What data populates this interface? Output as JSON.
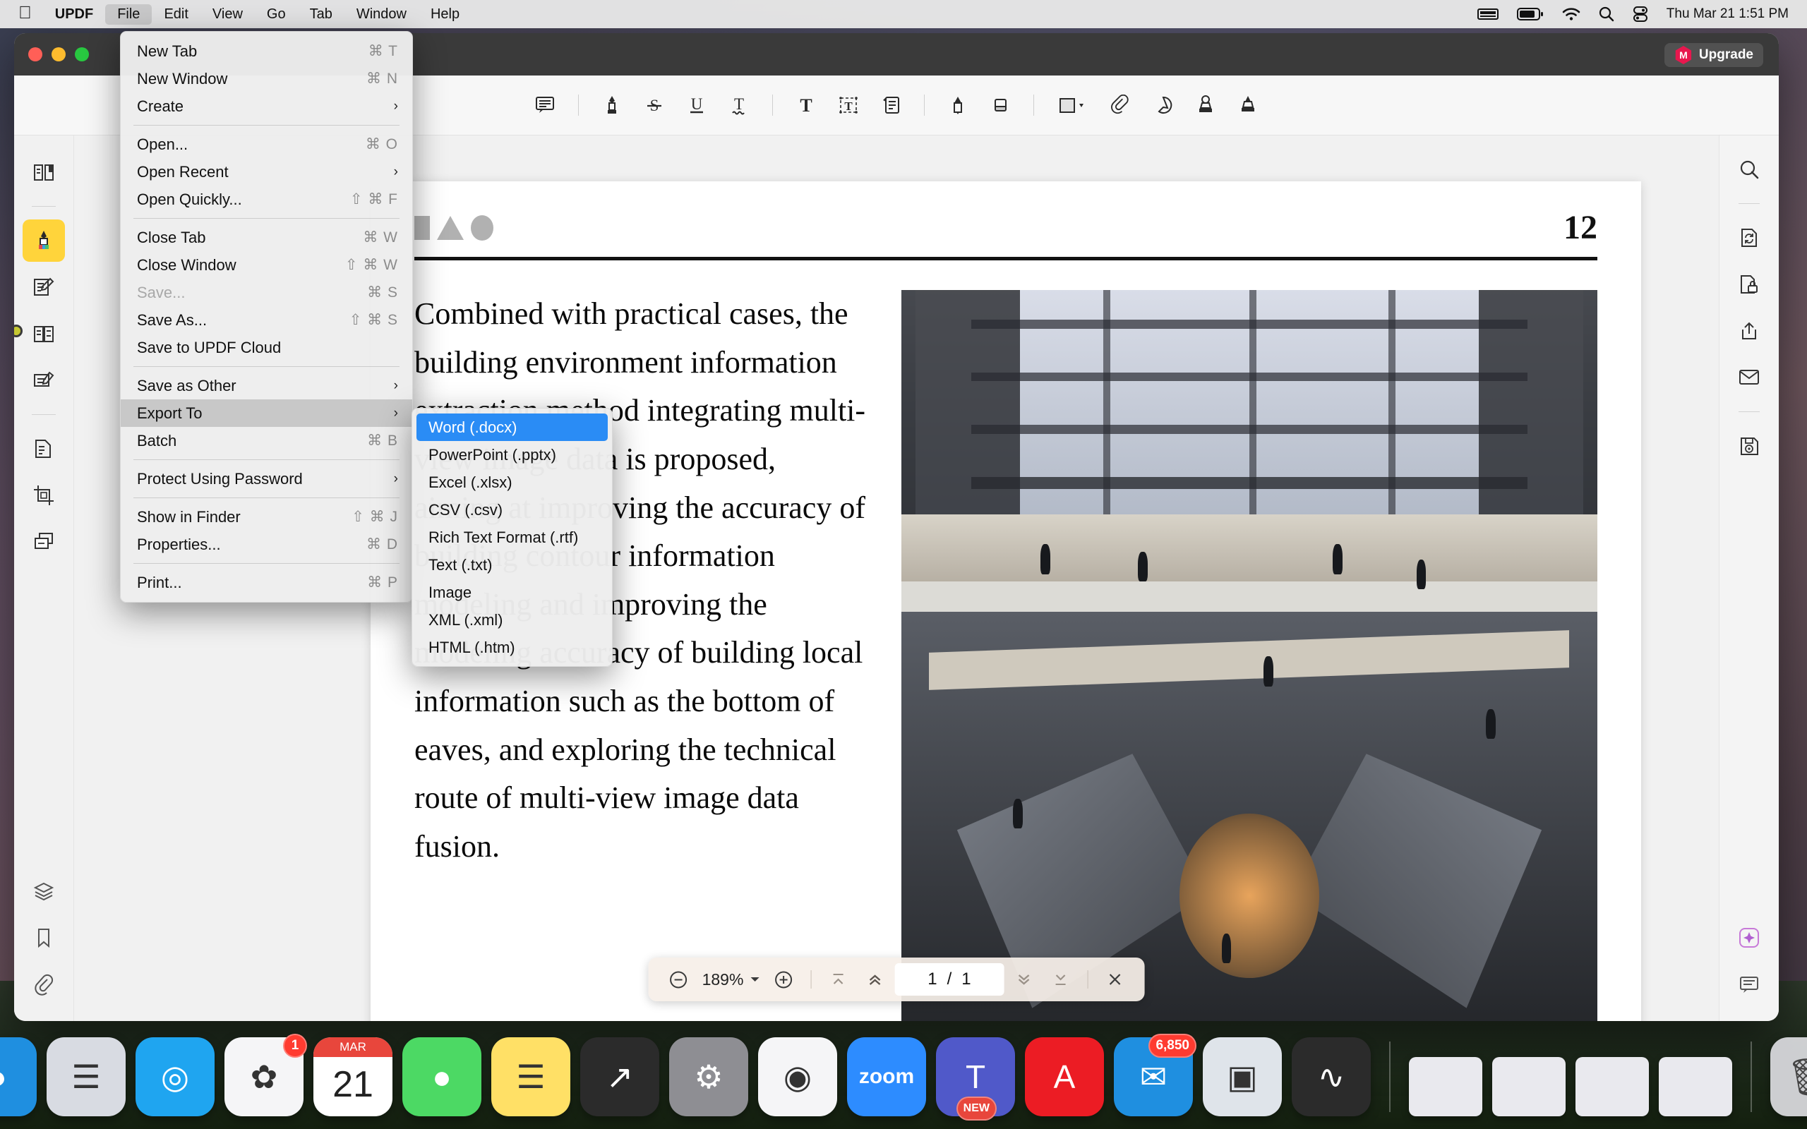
{
  "menubar": {
    "apple_icon": "apple-logo",
    "items": [
      {
        "label": "UPDF",
        "bold": true,
        "active": false
      },
      {
        "label": "File",
        "bold": false,
        "active": true
      },
      {
        "label": "Edit",
        "bold": false,
        "active": false
      },
      {
        "label": "View",
        "bold": false,
        "active": false
      },
      {
        "label": "Go",
        "bold": false,
        "active": false
      },
      {
        "label": "Tab",
        "bold": false,
        "active": false
      },
      {
        "label": "Window",
        "bold": false,
        "active": false
      },
      {
        "label": "Help",
        "bold": false,
        "active": false
      }
    ],
    "status": {
      "keyboard_icon": "keyboard-icon",
      "battery_icon": "battery-icon",
      "wifi_icon": "wifi-icon",
      "search_icon": "spotlight-search-icon",
      "control_center_icon": "control-center-icon",
      "clock": "Thu Mar 21  1:51 PM"
    }
  },
  "window": {
    "upgrade_label": "Upgrade",
    "upgrade_badge": "M",
    "upgrade_badge_color": "#e8174e"
  },
  "toolbar": {
    "groups": [
      {
        "items": [
          {
            "name": "comment-icon",
            "title": "Comment"
          }
        ]
      },
      {
        "items": [
          {
            "name": "highlight-icon",
            "title": "Highlight"
          },
          {
            "name": "strikethrough-icon",
            "title": "Strikethrough"
          },
          {
            "name": "underline-icon",
            "title": "Underline"
          },
          {
            "name": "squiggly-underline-icon",
            "title": "Squiggly"
          }
        ]
      },
      {
        "items": [
          {
            "name": "text-icon",
            "title": "Text"
          },
          {
            "name": "text-box-icon",
            "title": "Text Box"
          },
          {
            "name": "sticky-note-icon",
            "title": "Note"
          }
        ]
      },
      {
        "items": [
          {
            "name": "pencil-icon",
            "title": "Pencil"
          },
          {
            "name": "eraser-icon",
            "title": "Eraser"
          }
        ]
      },
      {
        "items": [
          {
            "name": "shape-icon",
            "title": "Shapes",
            "has_dropdown": true
          },
          {
            "name": "paperclip-icon",
            "title": "Attachment"
          },
          {
            "name": "sticker-icon",
            "title": "Sticker"
          },
          {
            "name": "stamp-icon",
            "title": "Stamp"
          },
          {
            "name": "signature-icon",
            "title": "Signature"
          }
        ]
      }
    ]
  },
  "left_rail": {
    "items": [
      {
        "name": "sidebar-item-reader",
        "icon": "book-reader-icon",
        "selected": false
      },
      {
        "name": "sidebar-item-annotate",
        "icon": "highlighter-icon",
        "selected": true
      },
      {
        "name": "sidebar-item-edit-pdf",
        "icon": "edit-document-icon",
        "selected": false
      },
      {
        "name": "sidebar-item-organize-pages",
        "icon": "organize-pages-icon",
        "selected": false
      },
      {
        "name": "sidebar-item-form",
        "icon": "form-icon",
        "selected": false
      },
      {
        "name": "sidebar-item-convert",
        "icon": "convert-document-icon",
        "selected": false
      },
      {
        "name": "sidebar-item-crop",
        "icon": "crop-icon",
        "selected": false
      },
      {
        "name": "sidebar-item-compare",
        "icon": "compare-pages-icon",
        "selected": false
      }
    ],
    "bottom_items": [
      {
        "name": "sidebar-item-layers",
        "icon": "layers-icon"
      },
      {
        "name": "sidebar-item-bookmarks",
        "icon": "bookmark-icon"
      },
      {
        "name": "sidebar-item-attachments",
        "icon": "paperclip-icon"
      }
    ]
  },
  "right_rail": {
    "items": [
      {
        "name": "search-button",
        "icon": "search-icon"
      },
      {
        "name": "convert-button",
        "icon": "convert-icon"
      },
      {
        "name": "protect-button",
        "icon": "protect-lock-icon"
      },
      {
        "name": "share-button",
        "icon": "share-upload-icon"
      },
      {
        "name": "email-button",
        "icon": "envelope-icon"
      },
      {
        "name": "save-button",
        "icon": "floppy-save-icon"
      }
    ],
    "bottom_items": [
      {
        "name": "ai-assistant-button",
        "icon": "ai-sparkle-icon"
      },
      {
        "name": "comment-list-button",
        "icon": "comment-icon"
      }
    ]
  },
  "document": {
    "page_number": "12",
    "header_shapes": [
      "square",
      "triangle",
      "circle"
    ],
    "body_text": "Combined with practical cases, the building environment information extraction method integrating multi-view image data is proposed, aiming at improving the accuracy of building contour information modeling and improving the modeling accuracy of building local information such as the bottom of eaves, and exploring the technical route of multi-view image data fusion.",
    "photo_alt": "atrium-interior-photograph"
  },
  "zoombar": {
    "zoom_out_icon": "minus-circle-icon",
    "zoom_level": "189%",
    "zoom_dropdown_icon": "chevron-down-icon",
    "zoom_in_icon": "plus-circle-icon",
    "first_page_icon": "first-page-icon",
    "prev_page_icon": "previous-page-icon",
    "current_page": "1",
    "page_separator": "/",
    "total_pages": "1",
    "next_page_icon": "next-page-icon",
    "last_page_icon": "last-page-icon",
    "close_icon": "close-icon"
  },
  "file_menu": {
    "sections": [
      [
        {
          "label": "New Tab",
          "key": "⌘ T"
        },
        {
          "label": "New Window",
          "key": "⌘ N"
        },
        {
          "label": "Create",
          "submenu": true
        }
      ],
      [
        {
          "label": "Open...",
          "key": "⌘ O"
        },
        {
          "label": "Open Recent",
          "submenu": true
        },
        {
          "label": "Open Quickly...",
          "key": "⇧ ⌘ F"
        }
      ],
      [
        {
          "label": "Close Tab",
          "key": "⌘ W"
        },
        {
          "label": "Close Window",
          "key": "⇧ ⌘ W"
        },
        {
          "label": "Save...",
          "key": "⌘ S",
          "disabled": true
        },
        {
          "label": "Save As...",
          "key": "⇧ ⌘ S"
        },
        {
          "label": "Save to UPDF Cloud"
        }
      ],
      [
        {
          "label": "Save as Other",
          "submenu": true
        },
        {
          "label": "Export To",
          "submenu": true,
          "highlighted": true
        },
        {
          "label": "Batch",
          "key": "⌘ B"
        }
      ],
      [
        {
          "label": "Protect Using Password",
          "submenu": true
        }
      ],
      [
        {
          "label": "Show in Finder",
          "key": "⇧ ⌘ J"
        },
        {
          "label": "Properties...",
          "key": "⌘ D"
        }
      ],
      [
        {
          "label": "Print...",
          "key": "⌘ P"
        }
      ]
    ]
  },
  "export_menu": {
    "items": [
      {
        "label": "Word (.docx)",
        "selected": true
      },
      {
        "label": "PowerPoint (.pptx)",
        "selected": false
      },
      {
        "label": "Excel (.xlsx)",
        "selected": false
      },
      {
        "label": "CSV (.csv)",
        "selected": false
      },
      {
        "label": "Rich Text Format (.rtf)",
        "selected": false
      },
      {
        "label": "Text (.txt)",
        "selected": false
      },
      {
        "label": "Image",
        "selected": false
      },
      {
        "label": "XML (.xml)",
        "selected": false
      },
      {
        "label": "HTML (.htm)",
        "selected": false
      }
    ],
    "selection_color": "#2a8cf5"
  },
  "dock": {
    "items": [
      {
        "name": "dock-finder",
        "glyph": "◕",
        "color": "#1f8fe0",
        "badge": null
      },
      {
        "name": "dock-launchpad",
        "glyph": "☰",
        "color": "#d8dbe2",
        "badge": null
      },
      {
        "name": "dock-safari",
        "glyph": "◎",
        "color": "#1fa5f0",
        "badge": null
      },
      {
        "name": "dock-photos",
        "glyph": "✿",
        "color": "#f5f5f7",
        "badge": "1"
      },
      {
        "name": "dock-calendar",
        "glyph": "21",
        "color": "#ffffff",
        "badge": null,
        "sublabel": "MAR"
      },
      {
        "name": "dock-messages",
        "glyph": "●",
        "color": "#4cd964",
        "badge": null
      },
      {
        "name": "dock-notes",
        "glyph": "☰",
        "color": "#ffe066",
        "badge": null
      },
      {
        "name": "dock-stocks",
        "glyph": "↗",
        "color": "#2b2b2b",
        "badge": null
      },
      {
        "name": "dock-settings",
        "glyph": "⚙",
        "color": "#8e8e93",
        "badge": null
      },
      {
        "name": "dock-chrome",
        "glyph": "◉",
        "color": "#f5f5f7",
        "badge": null
      },
      {
        "name": "dock-zoom",
        "glyph": "zoom",
        "color": "#2d8cff",
        "badge": null
      },
      {
        "name": "dock-teams",
        "glyph": "T",
        "color": "#5059c9",
        "badge": "NEW"
      },
      {
        "name": "dock-acrobat",
        "glyph": "A",
        "color": "#ec1c24",
        "badge": null
      },
      {
        "name": "dock-mail",
        "glyph": "✉",
        "color": "#1f8fe0",
        "badge": "6,850"
      },
      {
        "name": "dock-preview",
        "glyph": "▣",
        "color": "#dfe4ea",
        "badge": null
      },
      {
        "name": "dock-squiggle",
        "glyph": "∿",
        "color": "#2b2b2b",
        "badge": null
      }
    ],
    "minimized": [
      {
        "name": "dock-minimized-window-1"
      },
      {
        "name": "dock-minimized-window-2"
      },
      {
        "name": "dock-minimized-window-3"
      },
      {
        "name": "dock-minimized-window-4"
      }
    ],
    "trash": {
      "name": "dock-trash",
      "glyph": "🗑"
    }
  }
}
